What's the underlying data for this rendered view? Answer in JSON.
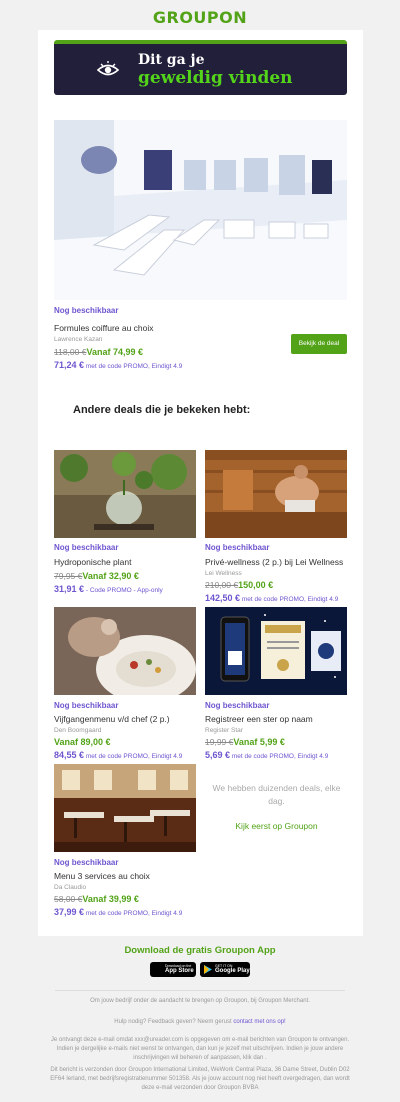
{
  "header": {
    "logo_text": "GROUPON"
  },
  "banner": {
    "line1": "Dit ga je",
    "line2": "geweldig vinden"
  },
  "featured": {
    "status": "Nog beschikbaar",
    "title": "Formules coiffure au choix",
    "merchant": "Lawrence Kazan",
    "old_price": "118,00 €",
    "price": "Vanaf 74,99 €",
    "promo_price": "71,24 €",
    "promo_text": "met de code PROMO, Eindigt 4.9",
    "button": "Bekijk de deal"
  },
  "section": {
    "title": "Andere deals die je bekeken hebt:"
  },
  "deals": [
    {
      "status": "Nog beschikbaar",
      "title": "Hydroponische plant",
      "merchant": "",
      "old_price": "79,95 €",
      "price": "Vanaf 32,90 €",
      "promo_price": "31,91 €",
      "promo_text": "- Code PROMO - App-only"
    },
    {
      "status": "Nog beschikbaar",
      "title": "Privé-wellness (2 p.) bij Lei Wellness",
      "merchant": "Lei Wellness",
      "old_price": "210,00 €",
      "price": "150,00 €",
      "promo_price": "142,50 €",
      "promo_text": "met de code PROMO, Eindigt 4.9"
    },
    {
      "status": "Nog beschikbaar",
      "title": "Vijfgangenmenu v/d chef (2 p.)",
      "merchant": "Den Boomgaard",
      "old_price": "",
      "price": "Vanaf 89,00 €",
      "promo_price": "84,55 €",
      "promo_text": "met de code PROMO, Eindigt 4.9"
    },
    {
      "status": "Nog beschikbaar",
      "title": "Registreer een ster op naam",
      "merchant": "Register Star",
      "old_price": "19,99 €",
      "price": "Vanaf 5,99 €",
      "promo_price": "5,69 €",
      "promo_text": "met de code PROMO, Eindigt 4.9"
    },
    {
      "status": "Nog beschikbaar",
      "title": "Menu 3 services au choix",
      "merchant": "Da Claudio",
      "old_price": "58,00 €",
      "price": "Vanaf 39,99 €",
      "promo_price": "37,99 €",
      "promo_text": "met de code PROMO, Eindigt 4.9"
    }
  ],
  "filler": {
    "text": "We hebben duizenden deals, elke dag.",
    "link": "Kijk eerst op Groupon"
  },
  "app": {
    "title": "Download de gratis Groupon App",
    "appstore_small": "Download on the",
    "appstore_label": "App Store",
    "googleplay_small": "GET IT ON",
    "googleplay_label": "Google Play"
  },
  "footer": {
    "merchant_line": "Om jouw bedrijf onder de aandacht te brengen op Groupon, bij Groupon Merchant.",
    "help_text": "Hulp nodig? Feedback geven? Neem gerust",
    "help_link": "contact met ons op!",
    "notice": "Je ontvangt deze e-mail omdat xxx@ureader.com is opgegeven om e-mail berichten van Groupon te ontvangen. Indien je dergelijke e-mails niet wenst te ontvangen, dan kun je jezelf met uitschrijven. Indien je jouw andere inschrijvingen wil beheren of aanpassen, klik dan .",
    "company": "Dit bericht is verzonden door Groupon International Limited, WeWork Central Plaza, 36 Dame Street, Dublin D02 EF64 Ierland, met bedrijfsregistratienummer 501358. Als je jouw account nog niet heeft overgedragen, dan wordt deze e-mail verzonden door Groupon BVBA"
  }
}
